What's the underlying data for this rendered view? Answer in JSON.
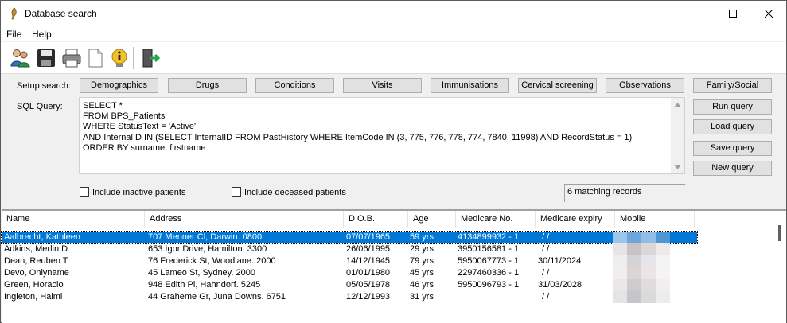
{
  "window": {
    "title": "Database search"
  },
  "menu": [
    "File",
    "Help"
  ],
  "toolbar": {
    "icons": [
      "patient-search-icon",
      "save-icon",
      "print-icon",
      "new-document-icon",
      "info-icon",
      "exit-icon"
    ]
  },
  "setup": {
    "label": "Setup search:",
    "buttons": [
      "Demographics",
      "Drugs",
      "Conditions",
      "Visits",
      "Immunisations",
      "Cervical screening",
      "Observations",
      "Family/Social"
    ]
  },
  "query": {
    "label": "SQL Query:",
    "text": "SELECT *\nFROM BPS_Patients\nWHERE StatusText = 'Active'\nAND InternalID IN (SELECT InternalID FROM PastHistory WHERE ItemCode IN (3, 775, 776, 778, 774, 7840, 11998) AND RecordStatus = 1)\nORDER BY surname, firstname"
  },
  "actions": {
    "run": "Run query",
    "load": "Load query",
    "save": "Save query",
    "new": "New query"
  },
  "options": {
    "inactive": "Include inactive patients",
    "deceased": "Include deceased patients"
  },
  "status": {
    "text": "6 matching records"
  },
  "table": {
    "columns": [
      "Name",
      "Address",
      "D.O.B.",
      "Age",
      "Medicare No.",
      "Medicare expiry",
      "Mobile"
    ],
    "rows": [
      {
        "name": "Aalbrecht, Kathleen",
        "address": "707 Menner Cl, Darwin. 0800",
        "dob": "07/07/1965",
        "age": "59 yrs",
        "medicare": "4134899932 - 1",
        "expiry": "/ /"
      },
      {
        "name": "Adkins, Merlin D",
        "address": "653 Igor Drive, Hamilton. 3300",
        "dob": "26/06/1995",
        "age": "29 yrs",
        "medicare": "3950156581 - 1",
        "expiry": "/ /"
      },
      {
        "name": "Dean, Reuben T",
        "address": "76 Frederick St, Woodlane. 2000",
        "dob": "14/12/1945",
        "age": "79 yrs",
        "medicare": "5950067773 - 1",
        "expiry": "30/11/2024"
      },
      {
        "name": "Devo, Onlyname",
        "address": "45 Lameo St, Sydney. 2000",
        "dob": "01/01/1980",
        "age": "45 yrs",
        "medicare": "2297460336 - 1",
        "expiry": "/ /"
      },
      {
        "name": "Green, Horacio",
        "address": "948 Edith Pl, Hahndorf. 5245",
        "dob": "05/05/1978",
        "age": "46 yrs",
        "medicare": "5950096793 - 1",
        "expiry": "31/03/2028"
      },
      {
        "name": "Ingleton, Haimi",
        "address": "44 Graheme Gr, Juna Downs. 6751",
        "dob": "12/12/1993",
        "age": "31 yrs",
        "medicare": "",
        "expiry": "/ /"
      }
    ]
  },
  "colors": {
    "selection": "#0078d7",
    "button_face": "#e1e1e1",
    "window_bg": "#f0f0f0"
  }
}
